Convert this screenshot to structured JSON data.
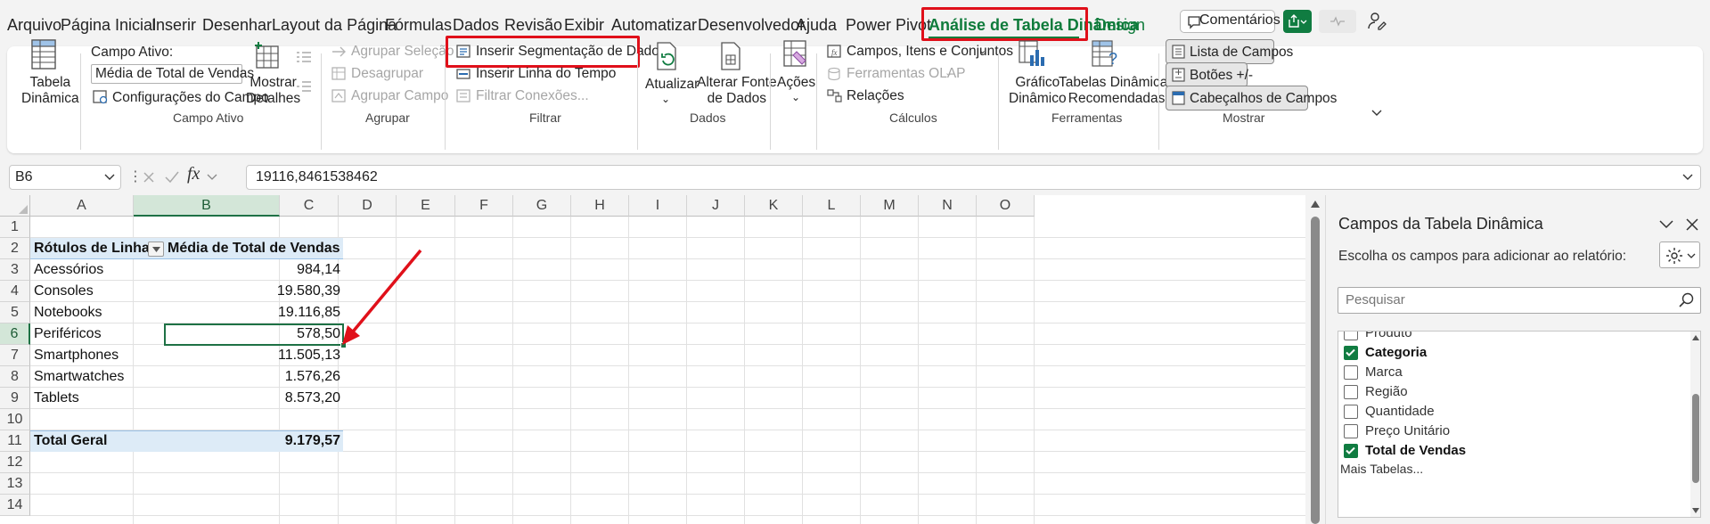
{
  "menu": {
    "items": [
      "Arquivo",
      "Página Inicial",
      "Inserir",
      "Desenhar",
      "Layout da Página",
      "Fórmulas",
      "Dados",
      "Revisão",
      "Exibir",
      "Automatizar",
      "Desenvolvedor",
      "Ajuda",
      "Power Pivot"
    ],
    "active": "Análise de Tabela Dinâmica",
    "design": "Design",
    "comments": "Comentários"
  },
  "ribbon": {
    "tabela_dinamica": "Tabela\nDinâmica",
    "campo_ativo_label": "Campo Ativo:",
    "campo_ativo_value": "Média de Total de Vendas",
    "config_campo": "Configurações do Campo",
    "mostrar_detalhes": "Mostrar\nDetalhes",
    "grp_campo_ativo": "Campo Ativo",
    "agrupar_selecao": "Agrupar Seleção",
    "desagrupar": "Desagrupar",
    "agrupar_campo": "Agrupar Campo",
    "grp_agrupar": "Agrupar",
    "inserir_segmentacao": "Inserir Segmentação de Dados",
    "inserir_linha_tempo": "Inserir Linha do Tempo",
    "filtrar_conexoes": "Filtrar Conexões...",
    "grp_filtrar": "Filtrar",
    "atualizar": "Atualizar",
    "alterar_fonte": "Alterar Fonte\nde Dados",
    "grp_dados": "Dados",
    "acoes": "Ações",
    "campos_itens": "Campos, Itens e Conjuntos",
    "ferramentas_olap": "Ferramentas OLAP",
    "relacoes": "Relações",
    "grp_calculos": "Cálculos",
    "grafico_dinamico": "Gráfico\nDinâmico",
    "tabelas_recomendadas": "Tabelas Dinâmicas\nRecomendadas",
    "grp_ferramentas": "Ferramentas",
    "lista_campos": "Lista de Campos",
    "botoes": "Botões +/-",
    "cabecalhos": "Cabeçalhos de Campos",
    "grp_mostrar": "Mostrar"
  },
  "formula_bar": {
    "name_box": "B6",
    "formula": "19116,8461538462",
    "fx": "fx"
  },
  "grid": {
    "columns": [
      "A",
      "B",
      "C",
      "D",
      "E",
      "F",
      "G",
      "H",
      "I",
      "J",
      "K",
      "L",
      "M",
      "N",
      "O"
    ],
    "rows": [
      "1",
      "2",
      "3",
      "4",
      "5",
      "6",
      "7",
      "8",
      "9",
      "10",
      "11",
      "12",
      "13",
      "14"
    ],
    "pivot_header_row": "Rótulos de Linha",
    "pivot_header_value": "Média de Total de Vendas",
    "pivot_rows": [
      {
        "label": "Acessórios",
        "value": "984,14"
      },
      {
        "label": "Consoles",
        "value": "19.580,39"
      },
      {
        "label": "Notebooks",
        "value": "19.116,85"
      },
      {
        "label": "Periféricos",
        "value": "578,50"
      },
      {
        "label": "Smartphones",
        "value": "11.505,13"
      },
      {
        "label": "Smartwatches",
        "value": "1.576,26"
      },
      {
        "label": "Tablets",
        "value": "8.573,20"
      }
    ],
    "total_label": "Total Geral",
    "total_value": "9.179,57"
  },
  "pane": {
    "title": "Campos da Tabela Dinâmica",
    "subtitle": "Escolha os campos para adicionar ao relatório:",
    "search_placeholder": "Pesquisar",
    "fields": [
      {
        "label": "Produto",
        "checked": false,
        "bold": false
      },
      {
        "label": "Categoria",
        "checked": true,
        "bold": true
      },
      {
        "label": "Marca",
        "checked": false,
        "bold": false
      },
      {
        "label": "Região",
        "checked": false,
        "bold": false
      },
      {
        "label": "Quantidade",
        "checked": false,
        "bold": false
      },
      {
        "label": "Preço Unitário",
        "checked": false,
        "bold": false
      },
      {
        "label": "Total de Vendas",
        "checked": true,
        "bold": true
      }
    ],
    "more_tables": "Mais Tabelas..."
  },
  "colors": {
    "accent": "#0f7b3b",
    "highlight": "#e0101a",
    "pivot_band": "#ddebf7",
    "arrow": "#e0101a"
  }
}
